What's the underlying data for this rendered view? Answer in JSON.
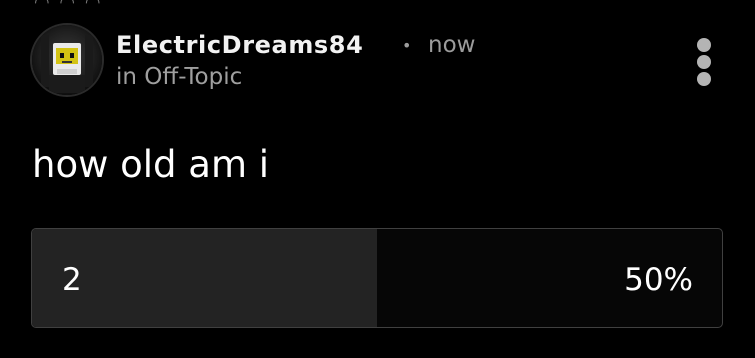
{
  "post": {
    "author": "ElectricDreams84",
    "separator": "•",
    "timestamp": "now",
    "category": "in Off-Topic",
    "text": "how old am i",
    "avatar_icon": "robot-avatar-icon",
    "menu_icon": "more-vertical-icon"
  },
  "poll": {
    "options": [
      {
        "label": "2",
        "percent_label": "50%",
        "percent": 50
      }
    ]
  },
  "colors": {
    "background": "#000000",
    "text_primary": "#ffffff",
    "text_secondary": "#9c9c9c",
    "poll_fill": "#232323",
    "poll_border": "#404040"
  }
}
